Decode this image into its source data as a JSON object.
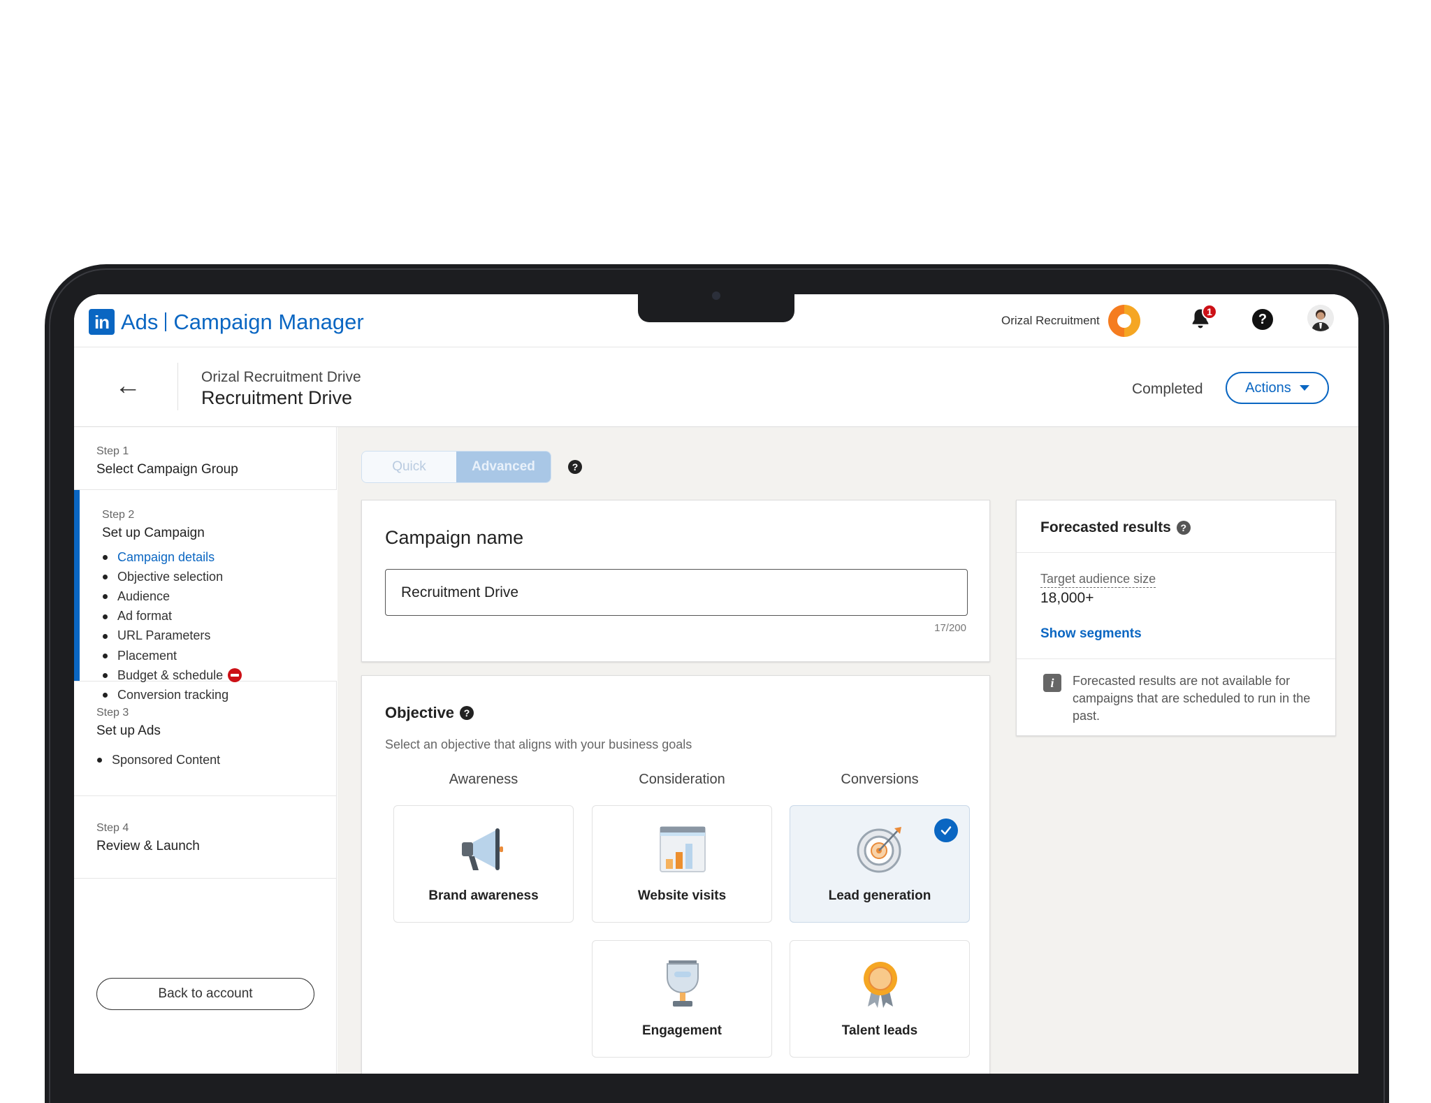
{
  "brand": {
    "logo_text": "in",
    "ads": "Ads",
    "product": "Campaign Manager"
  },
  "topbar": {
    "account_name": "Orizal Recruitment",
    "notification_count": "1",
    "help_glyph": "?"
  },
  "header": {
    "breadcrumb": "Orizal Recruitment Drive",
    "title": "Recruitment Drive",
    "status": "Completed",
    "actions_label": "Actions",
    "back_glyph": "←"
  },
  "sidebar": {
    "step1": {
      "label": "Step 1",
      "title": "Select Campaign Group"
    },
    "step2": {
      "label": "Step 2",
      "title": "Set up Campaign",
      "items": [
        "Campaign details",
        "Objective selection",
        "Audience",
        "Ad format",
        "URL Parameters",
        "Placement",
        "Budget & schedule",
        "Conversion tracking"
      ]
    },
    "step3": {
      "label": "Step 3",
      "title": "Set up Ads",
      "items": [
        "Sponsored Content"
      ]
    },
    "step4": {
      "label": "Step 4",
      "title": "Review & Launch"
    },
    "back_label": "Back to account"
  },
  "mode_toggle": {
    "quick": "Quick",
    "advanced": "Advanced",
    "selected": "Advanced"
  },
  "campaign_name": {
    "title": "Campaign name",
    "value": "Recruitment Drive",
    "char_count": "17/200"
  },
  "objective": {
    "title": "Objective",
    "description": "Select an objective that aligns with your business goals",
    "columns": [
      "Awareness",
      "Consideration",
      "Conversions"
    ],
    "tiles": [
      {
        "label": "Brand awareness",
        "icon": "megaphone-icon"
      },
      {
        "label": "Website visits",
        "icon": "bar-chart-window-icon"
      },
      {
        "label": "Lead generation",
        "icon": "target-icon",
        "selected": true
      },
      {
        "label": "Engagement",
        "icon": "trophy-icon"
      },
      {
        "label": "Talent leads",
        "icon": "award-ribbon-icon"
      }
    ]
  },
  "forecast": {
    "title": "Forecasted results",
    "audience_label": "Target audience size",
    "audience_value": "18,000+",
    "show_segments": "Show segments",
    "info_glyph": "i",
    "note": "Forecasted results are not available for campaigns that are scheduled to run in the past."
  },
  "colors": {
    "brand_blue": "#0a66c2",
    "alert_red": "#cc1016",
    "canvas": "#f3f2ef"
  }
}
